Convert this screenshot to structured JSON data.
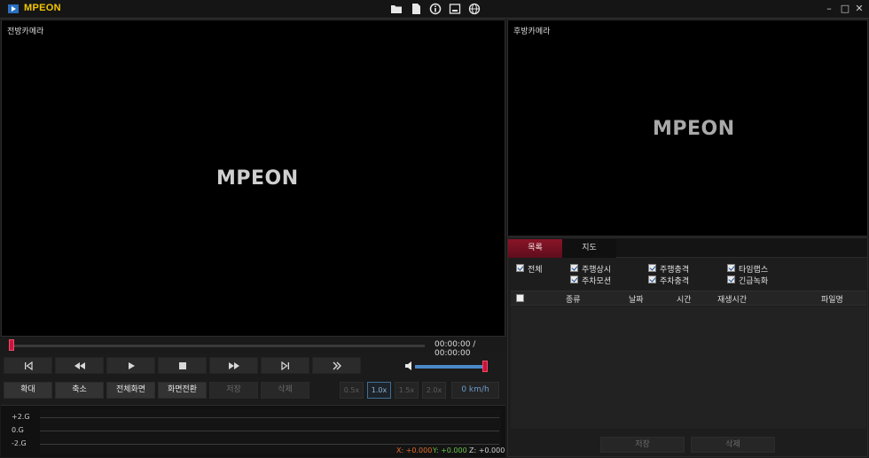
{
  "app": {
    "title": "MPEON"
  },
  "toolbar_icons": [
    "folder-icon",
    "sd-card-icon",
    "info-icon",
    "screenshot-icon",
    "globe-icon"
  ],
  "window_controls": {
    "minimize": "–",
    "maximize": "□",
    "close": "✕"
  },
  "front_camera": {
    "label": "전방카메라",
    "logo": "MPEON"
  },
  "rear_camera": {
    "label": "후방카메라",
    "logo": "MPEON"
  },
  "seek": {
    "time": "00:00:00 / 00:00:00",
    "progress": 0.0
  },
  "volume": {
    "level": 1.0
  },
  "action_buttons": {
    "zoom_in": "확대",
    "zoom_out": "축소",
    "fullscreen": "전체화면",
    "switch_view": "화면전환",
    "save": "저장",
    "delete": "삭제"
  },
  "speed_options": [
    "0.5x",
    "1.0x",
    "1.5x",
    "2.0x"
  ],
  "speed_selected": "1.0x",
  "speed_readout": "0 km/h",
  "gsensor": {
    "labels": [
      "+2.G",
      "0.G",
      "-2.G"
    ],
    "x": "X: +0.000",
    "y": "Y: +0.000",
    "z": "Z: +0.000",
    "colors": {
      "x": "#e06a2a",
      "y": "#6ac24a",
      "z": "#cfcfcf"
    }
  },
  "panel": {
    "tabs": [
      "목록",
      "지도"
    ],
    "active_tab": "목록",
    "filters": [
      {
        "label": "전체",
        "checked": true
      },
      {
        "label": "주행상시",
        "checked": true
      },
      {
        "label": "주행충격",
        "checked": true
      },
      {
        "label": "타임랩스",
        "checked": true
      },
      {
        "label": "주차모션",
        "checked": true
      },
      {
        "label": "주차충격",
        "checked": true
      },
      {
        "label": "긴급녹화",
        "checked": true
      }
    ],
    "columns": [
      "종류",
      "날짜",
      "시간",
      "재생시간",
      "파일명"
    ],
    "save": "저장",
    "delete": "삭제"
  },
  "accent_color": "#c8143c"
}
